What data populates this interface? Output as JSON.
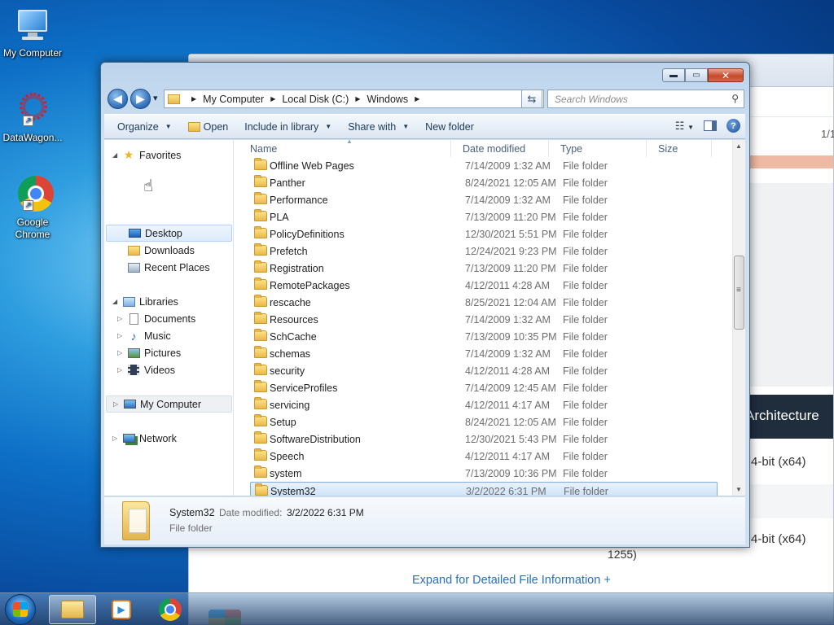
{
  "desktop": {
    "icons": [
      {
        "label": "My Computer"
      },
      {
        "label": "DataWagon..."
      },
      {
        "label": "Google Chrome"
      }
    ]
  },
  "background_page": {
    "page_counter": "1/1",
    "architecture_label": "Architecture",
    "row1": "4-bit (x64)",
    "row2": "4-bit (x64)",
    "row3": "1255)",
    "expand_link": "Expand for Detailed File Information +"
  },
  "window": {
    "controls": {
      "minimize": "▬",
      "maximize": "▭",
      "close": "✕"
    },
    "nav": {
      "back": "◀",
      "forward": "▶",
      "history": "▾"
    },
    "breadcrumb": [
      "My Computer",
      "Local Disk (C:)",
      "Windows"
    ],
    "search_placeholder": "Search Windows",
    "toolbar": {
      "organize": "Organize",
      "open": "Open",
      "include_in_library": "Include in library",
      "share_with": "Share with",
      "new_folder": "New folder"
    },
    "sidebar": {
      "favorites": {
        "label": "Favorites",
        "items": [
          {
            "label": "Desktop"
          },
          {
            "label": "Downloads"
          },
          {
            "label": "Recent Places"
          }
        ]
      },
      "libraries": {
        "label": "Libraries",
        "items": [
          {
            "label": "Documents"
          },
          {
            "label": "Music"
          },
          {
            "label": "Pictures"
          },
          {
            "label": "Videos"
          }
        ]
      },
      "computer": {
        "label": "My Computer"
      },
      "network": {
        "label": "Network"
      }
    },
    "columns": {
      "name": "Name",
      "date": "Date modified",
      "type": "Type",
      "size": "Size"
    },
    "files": [
      {
        "name": "Offline Web Pages",
        "date": "7/14/2009 1:32 AM",
        "type": "File folder"
      },
      {
        "name": "Panther",
        "date": "8/24/2021 12:05 AM",
        "type": "File folder"
      },
      {
        "name": "Performance",
        "date": "7/14/2009 1:32 AM",
        "type": "File folder"
      },
      {
        "name": "PLA",
        "date": "7/13/2009 11:20 PM",
        "type": "File folder"
      },
      {
        "name": "PolicyDefinitions",
        "date": "12/30/2021 5:51 PM",
        "type": "File folder"
      },
      {
        "name": "Prefetch",
        "date": "12/24/2021 9:23 PM",
        "type": "File folder"
      },
      {
        "name": "Registration",
        "date": "7/13/2009 11:20 PM",
        "type": "File folder"
      },
      {
        "name": "RemotePackages",
        "date": "4/12/2011 4:28 AM",
        "type": "File folder"
      },
      {
        "name": "rescache",
        "date": "8/25/2021 12:04 AM",
        "type": "File folder"
      },
      {
        "name": "Resources",
        "date": "7/14/2009 1:32 AM",
        "type": "File folder"
      },
      {
        "name": "SchCache",
        "date": "7/13/2009 10:35 PM",
        "type": "File folder"
      },
      {
        "name": "schemas",
        "date": "7/14/2009 1:32 AM",
        "type": "File folder"
      },
      {
        "name": "security",
        "date": "4/12/2011 4:28 AM",
        "type": "File folder"
      },
      {
        "name": "ServiceProfiles",
        "date": "7/14/2009 12:45 AM",
        "type": "File folder"
      },
      {
        "name": "servicing",
        "date": "4/12/2011 4:17 AM",
        "type": "File folder"
      },
      {
        "name": "Setup",
        "date": "8/24/2021 12:05 AM",
        "type": "File folder"
      },
      {
        "name": "SoftwareDistribution",
        "date": "12/30/2021 5:43 PM",
        "type": "File folder"
      },
      {
        "name": "Speech",
        "date": "4/12/2011 4:17 AM",
        "type": "File folder"
      },
      {
        "name": "system",
        "date": "7/13/2009 10:36 PM",
        "type": "File folder"
      },
      {
        "name": "System32",
        "date": "3/2/2022 6:31 PM",
        "type": "File folder",
        "selected": true
      }
    ],
    "details": {
      "name": "System32",
      "date_label": "Date modified:",
      "date_value": "3/2/2022 6:31 PM",
      "type": "File folder"
    }
  },
  "colors": {
    "selection": "#cbe1f9",
    "selection_border": "#84acdd",
    "link": "#2a6fb8",
    "folder": "#e9b84a"
  }
}
